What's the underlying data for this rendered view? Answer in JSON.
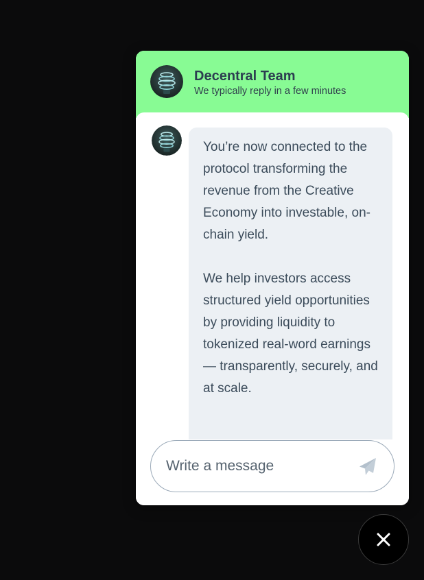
{
  "header": {
    "team_name": "Decentral Team",
    "status": "We typically reply in a few minutes",
    "background_color": "#88fb94",
    "avatar_icon": "spiral-logo-avatar"
  },
  "messages": [
    {
      "sender_avatar_icon": "spiral-logo-avatar",
      "paragraphs": [
        "You’re now connected to the protocol transforming the revenue from the Creative Economy into investable, on-chain yield.",
        "We help investors access structured yield opportunities by providing liquidity to tokenized real-word earnings — transparently, securely, and at scale."
      ]
    }
  ],
  "composer": {
    "placeholder": "Write a message",
    "value": "",
    "send_icon": "paper-plane-icon"
  },
  "launcher": {
    "icon": "close-icon",
    "color": "#000000"
  }
}
